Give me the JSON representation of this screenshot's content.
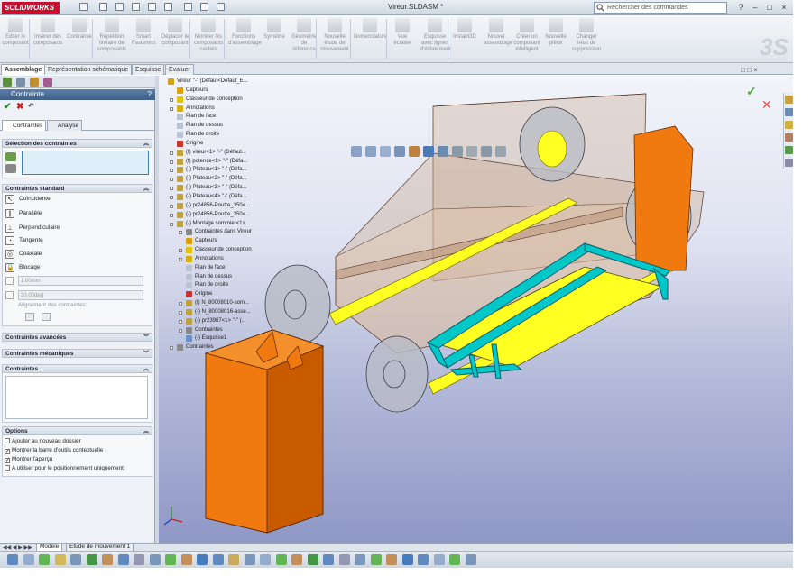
{
  "app": {
    "brand": "SOLIDWORKS",
    "document_title": "Vireur.SLDASM *"
  },
  "search": {
    "placeholder": "Rechercher des commandes"
  },
  "ribbon": {
    "items": [
      {
        "label": "Editer le composant",
        "icon": "edit-component-icon"
      },
      {
        "label": "Insérer des composants",
        "icon": "insert-components-icon"
      },
      {
        "label": "Contrainte",
        "icon": "mate-icon"
      },
      {
        "label": "Répétition linéaire de composants",
        "icon": "linear-pattern-icon"
      },
      {
        "label": "Smart Fasteners",
        "icon": "smart-fasteners-icon"
      },
      {
        "label": "Déplacer le composant",
        "icon": "move-component-icon"
      },
      {
        "label": "Montrer les composants cachés",
        "icon": "show-hidden-icon"
      },
      {
        "label": "Fonctions d'assemblage",
        "icon": "assembly-features-icon"
      },
      {
        "label": "Symétrie",
        "icon": "mirror-icon"
      },
      {
        "label": "Géométrie de référence",
        "icon": "reference-geometry-icon"
      },
      {
        "label": "Nouvelle étude de mouvement",
        "icon": "motion-study-icon"
      },
      {
        "label": "Nomenclature",
        "icon": "bom-icon"
      },
      {
        "label": "Vue éclatée",
        "icon": "exploded-view-icon"
      },
      {
        "label": "Esquisse avec lignes d'éclatement",
        "icon": "explode-line-sketch-icon"
      },
      {
        "label": "Instant3D",
        "icon": "instant3d-icon"
      },
      {
        "label": "Nouvel assemblage",
        "icon": "new-assembly-icon"
      },
      {
        "label": "Créer un composant intelligent",
        "icon": "smart-component-icon"
      },
      {
        "label": "Nouvelle pièce",
        "icon": "new-part-icon"
      },
      {
        "label": "Changer l'état de suppression",
        "icon": "suppression-state-icon"
      }
    ]
  },
  "tabs": [
    "Assemblage",
    "Représentation schématique",
    "Esquisse",
    "Evaluer"
  ],
  "panel": {
    "title": "Contrainte",
    "help": "?",
    "subtabs": [
      "Contraintes",
      "Analyse"
    ],
    "sections": {
      "selection": "Sélection des contraintes",
      "standard": "Contraintes standard",
      "advanced": "Contraintes avancées",
      "mechanical": "Contraintes mécaniques",
      "list": "Contraintes",
      "options": "Options"
    },
    "standard_mates": [
      {
        "label": "Coïncidente",
        "symbol": "↖"
      },
      {
        "label": "Parallèle",
        "symbol": "∥"
      },
      {
        "label": "Perpendiculaire",
        "symbol": "⊥"
      },
      {
        "label": "Tangente",
        "symbol": "◔"
      },
      {
        "label": "Coaxiale",
        "symbol": "◎"
      },
      {
        "label": "Blocage",
        "symbol": "🔒"
      }
    ],
    "distance_value": "1.00mm",
    "angle_value": "30.00deg",
    "alignment_label": "Alignement des contraintes:",
    "options": [
      {
        "label": "Ajouter au nouveau dossier",
        "checked": false
      },
      {
        "label": "Montrer la barre d'outils contextuelle",
        "checked": true
      },
      {
        "label": "Montrer l'aperçu",
        "checked": true
      },
      {
        "label": "A utiliser pour le positionnement uniquement",
        "checked": false
      }
    ]
  },
  "tree": [
    {
      "label": "Vireur \"-\" (Défaut<Défaut_E...",
      "indent": 0,
      "expand": false,
      "icon": "assembly-icon",
      "color": "#d4a017"
    },
    {
      "label": "Capteurs",
      "indent": 1,
      "expand": false,
      "icon": "sensors-icon",
      "color": "#e0a000"
    },
    {
      "label": "Classeur de conception",
      "indent": 1,
      "expand": true,
      "icon": "design-binder-icon",
      "color": "#e6c200"
    },
    {
      "label": "Annotations",
      "indent": 1,
      "expand": true,
      "icon": "annotations-icon",
      "color": "#d8b000"
    },
    {
      "label": "Plan de face",
      "indent": 1,
      "expand": false,
      "icon": "plane-icon",
      "color": "#b9c4d0"
    },
    {
      "label": "Plan de dessus",
      "indent": 1,
      "expand": false,
      "icon": "plane-icon",
      "color": "#b9c4d0"
    },
    {
      "label": "Plan de droite",
      "indent": 1,
      "expand": false,
      "icon": "plane-icon",
      "color": "#b9c4d0"
    },
    {
      "label": "Origine",
      "indent": 1,
      "expand": false,
      "icon": "origin-icon",
      "color": "#cc3333"
    },
    {
      "label": "(f) vireur<1> \"-\" (Défaut...",
      "indent": 1,
      "expand": true,
      "icon": "part-icon",
      "color": "#c2a23a"
    },
    {
      "label": "(f) potence<1> \"-\" (Défa...",
      "indent": 1,
      "expand": true,
      "icon": "part-icon",
      "color": "#c2a23a"
    },
    {
      "label": "(-) Plateau<1> \"-\" (Défa...",
      "indent": 1,
      "expand": true,
      "icon": "part-icon",
      "color": "#c2a23a"
    },
    {
      "label": "(-) Plateau<2> \"-\" (Défa...",
      "indent": 1,
      "expand": true,
      "icon": "part-icon",
      "color": "#c2a23a"
    },
    {
      "label": "(-) Plateau<3> \"-\" (Défa...",
      "indent": 1,
      "expand": true,
      "icon": "part-icon",
      "color": "#c2a23a"
    },
    {
      "label": "(-) Plateau<4> \"-\" (Défa...",
      "indent": 1,
      "expand": true,
      "icon": "part-icon",
      "color": "#c2a23a"
    },
    {
      "label": "(-) pr24856-Poutre_350<...",
      "indent": 1,
      "expand": true,
      "icon": "part-icon",
      "color": "#c2a23a"
    },
    {
      "label": "(-) pr24856-Poutre_350<...",
      "indent": 1,
      "expand": true,
      "icon": "part-icon",
      "color": "#c2a23a"
    },
    {
      "label": "(-) Montage sommier<1>...",
      "indent": 1,
      "expand": true,
      "icon": "subassembly-icon",
      "color": "#c2a23a"
    },
    {
      "label": "Contraintes dans Vireur",
      "indent": 2,
      "expand": true,
      "icon": "mates-folder-icon",
      "color": "#8a8a8a"
    },
    {
      "label": "Capteurs",
      "indent": 2,
      "expand": false,
      "icon": "sensors-icon",
      "color": "#e0a000"
    },
    {
      "label": "Classeur de conception",
      "indent": 2,
      "expand": true,
      "icon": "design-binder-icon",
      "color": "#e6c200"
    },
    {
      "label": "Annotations",
      "indent": 2,
      "expand": true,
      "icon": "annotations-icon",
      "color": "#d8b000"
    },
    {
      "label": "Plan de face",
      "indent": 2,
      "expand": false,
      "icon": "plane-icon",
      "color": "#b9c4d0"
    },
    {
      "label": "Plan de dessus",
      "indent": 2,
      "expand": false,
      "icon": "plane-icon",
      "color": "#b9c4d0"
    },
    {
      "label": "Plan de droite",
      "indent": 2,
      "expand": false,
      "icon": "plane-icon",
      "color": "#b9c4d0"
    },
    {
      "label": "Origine",
      "indent": 2,
      "expand": false,
      "icon": "origin-icon",
      "color": "#cc3333"
    },
    {
      "label": "(f) N_80008010-som...",
      "indent": 2,
      "expand": true,
      "icon": "part-icon",
      "color": "#c2a23a"
    },
    {
      "label": "(-) N_80008016-asse...",
      "indent": 2,
      "expand": true,
      "icon": "part-icon",
      "color": "#c2a23a"
    },
    {
      "label": "(-) pr23987<1> \"-\" (...",
      "indent": 2,
      "expand": true,
      "icon": "part-icon",
      "color": "#c2a23a"
    },
    {
      "label": "Contraintes",
      "indent": 2,
      "expand": true,
      "icon": "mates-folder-icon",
      "color": "#8a8a8a"
    },
    {
      "label": "(-) Esquisse1",
      "indent": 2,
      "expand": false,
      "icon": "sketch-icon",
      "color": "#6b8ec5"
    },
    {
      "label": "Contraintes",
      "indent": 1,
      "expand": true,
      "icon": "mates-folder-icon",
      "color": "#8a8a8a"
    }
  ],
  "bottom_tabs": [
    "Modèle",
    "Etude de mouvement 1"
  ],
  "colors": {
    "accent": "#c8102e",
    "selection": "#3d7fb8",
    "frame": "#ffff00",
    "cradle": "#00c8c8",
    "stand": "#f07a10"
  }
}
